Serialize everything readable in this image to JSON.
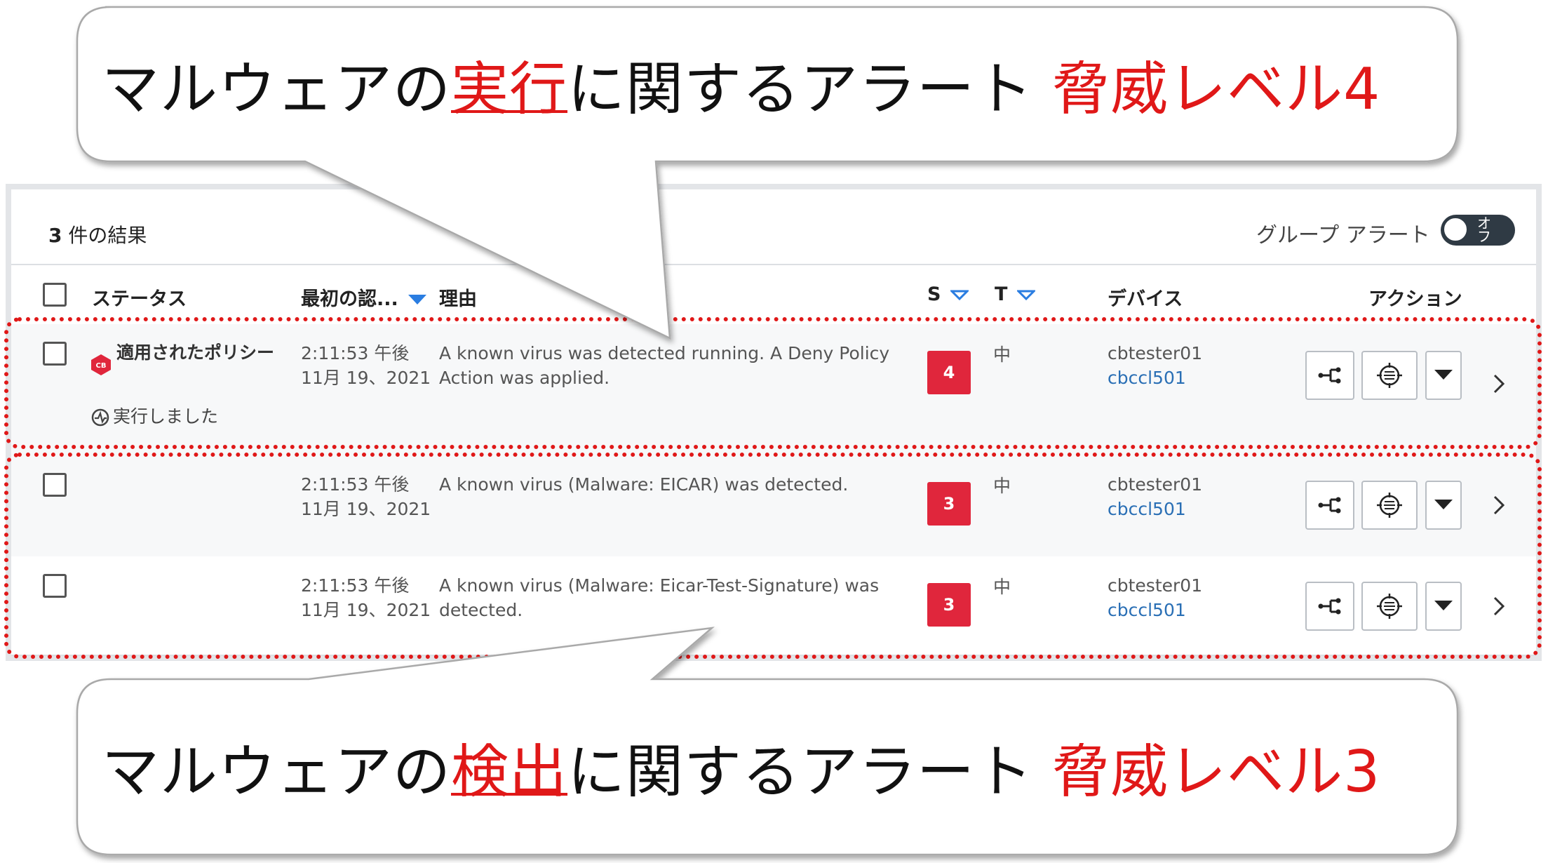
{
  "results": {
    "count": "3",
    "suffix": " 件の結果"
  },
  "group_alerts": {
    "label": "グループ アラート",
    "toggle_text": "オフ"
  },
  "columns": {
    "status": "ステータス",
    "first_seen": "最初の認...",
    "reason": "理由",
    "severity": "S",
    "ttp": "T",
    "device": "デバイス",
    "actions": "アクション"
  },
  "rows": [
    {
      "status_title": "適用されたポリシー",
      "status_sub": "実行しました",
      "time": "2:11:53 午後",
      "date": "11月 19、2021",
      "reason": "A known virus was detected running. A Deny Policy Action was applied.",
      "severity": "4",
      "ttp": "中",
      "device_user": "cbtester01",
      "device_name": "cbccl501"
    },
    {
      "status_title": "",
      "status_sub": "",
      "time": "2:11:53 午後",
      "date": "11月 19、2021",
      "reason": "A known virus (Malware: EICAR) was detected.",
      "severity": "3",
      "ttp": "中",
      "device_user": "cbtester01",
      "device_name": "cbccl501"
    },
    {
      "status_title": "",
      "status_sub": "",
      "time": "2:11:53 午後",
      "date": "11月 19、2021",
      "reason": "A known virus (Malware: Eicar-Test-Signature) was detected.",
      "severity": "3",
      "ttp": "中",
      "device_user": "cbtester01",
      "device_name": "cbccl501"
    }
  ],
  "callout_top": {
    "prefix": "マルウェアの",
    "emph": "実行",
    "middle": "に関するアラート ",
    "level": "脅威レベル4"
  },
  "callout_bottom": {
    "prefix": "マルウェアの",
    "emph": "検出",
    "middle": "に関するアラート ",
    "level": "脅威レベル3"
  },
  "colors": {
    "threat_badge": "#e0263c",
    "annotation_red": "#e01818",
    "link_blue": "#2a6fb5",
    "caret_blue": "#2a7de1"
  },
  "icons": [
    "cb-policy-icon",
    "run-icon",
    "process-tree-icon",
    "investigate-icon",
    "dropdown-caret-icon",
    "chevron-right-icon",
    "sort-caret-icon"
  ]
}
